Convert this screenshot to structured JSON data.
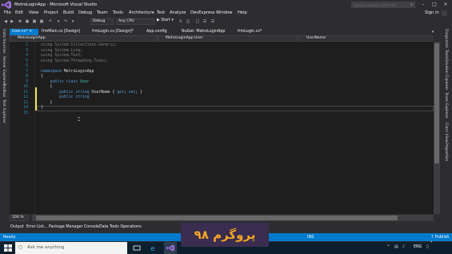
{
  "window": {
    "title": "MetroLoginApp - Microsoft Visual Studio",
    "quick_launch_placeholder": "Quick Launch (Ctrl+Q)",
    "sign_in": "Sign in"
  },
  "menu": [
    "File",
    "Edit",
    "View",
    "Project",
    "Build",
    "Debug",
    "Team",
    "Tools",
    "Architecture",
    "Test",
    "Analyze",
    "DevExpress",
    "Window",
    "Help"
  ],
  "toolbar": {
    "configuration": "Debug",
    "platform": "Any CPU",
    "start_label": "▶ Start ▾"
  },
  "left_panels": [
    "Data Sources",
    "Server Explorer",
    "Toolbox",
    "Test Explorer"
  ],
  "right_panels": [
    "Diagnostic Tools",
    "Solution Explorer",
    "Team Explorer",
    "Class View",
    "Properties"
  ],
  "doc_tabs": [
    "User.cs*",
    "frmMain.cs [Design]",
    "frmLogin.cs [Design]*",
    "App.config",
    "NuGet: MetroLoginApp",
    "frmLogin.cs*"
  ],
  "nav_bar": {
    "project": "MetroLoginApp",
    "class": "MetroLoginApp.User",
    "member": "UserName"
  },
  "code_lines": [
    {
      "n": "2",
      "parts": [
        [
          "gray",
          "using System.Collections.Generic;"
        ]
      ]
    },
    {
      "n": "3",
      "parts": [
        [
          "gray",
          "using System.Linq;"
        ]
      ]
    },
    {
      "n": "4",
      "parts": [
        [
          "gray",
          "using System.Text;"
        ]
      ]
    },
    {
      "n": "5",
      "parts": [
        [
          "gray",
          "using System.Threading.Tasks;"
        ]
      ]
    },
    {
      "n": "6",
      "parts": []
    },
    {
      "n": "7",
      "parts": [
        [
          "kw",
          "namespace"
        ],
        [
          "",
          " MetroLoginApp"
        ]
      ]
    },
    {
      "n": "8",
      "parts": [
        [
          "",
          "{"
        ]
      ]
    },
    {
      "n": "9",
      "parts": [
        [
          "",
          "    "
        ],
        [
          "kw",
          "public class"
        ],
        [
          "",
          " "
        ],
        [
          "ty",
          "User"
        ]
      ]
    },
    {
      "n": "10",
      "parts": [
        [
          "",
          "    {"
        ]
      ]
    },
    {
      "n": "11",
      "parts": [
        [
          "",
          "        "
        ],
        [
          "kw",
          "public string"
        ],
        [
          "",
          " UserName { "
        ],
        [
          "kw",
          "get"
        ],
        [
          "",
          "; "
        ],
        [
          "kw",
          "set"
        ],
        [
          "",
          "; }"
        ]
      ]
    },
    {
      "n": "12",
      "parts": [
        [
          "",
          "        "
        ],
        [
          "kw",
          "public string"
        ]
      ]
    },
    {
      "n": "13",
      "parts": [
        [
          "",
          "    }"
        ]
      ]
    },
    {
      "n": "14",
      "parts": [
        [
          "",
          "}"
        ]
      ]
    },
    {
      "n": "15",
      "parts": []
    }
  ],
  "zoom": "100 %",
  "output_tabs": [
    "Output",
    "Error List...",
    "Package Manager Console",
    "Data Tools Operations"
  ],
  "status": {
    "ready": "Ready",
    "ins": "INS",
    "publish": "↑ Publish ▴"
  },
  "banner": "پروگرم ۹۸",
  "taskbar": {
    "search_placeholder": "Ask me anything",
    "lang": "ENG"
  },
  "colors": {
    "accent": "#007acc",
    "editor_bg": "#1e1e1e",
    "chrome_bg": "#2d2d30",
    "keyword": "#569cd6",
    "type": "#4ec9b0",
    "banner_text": "#f3a623"
  }
}
